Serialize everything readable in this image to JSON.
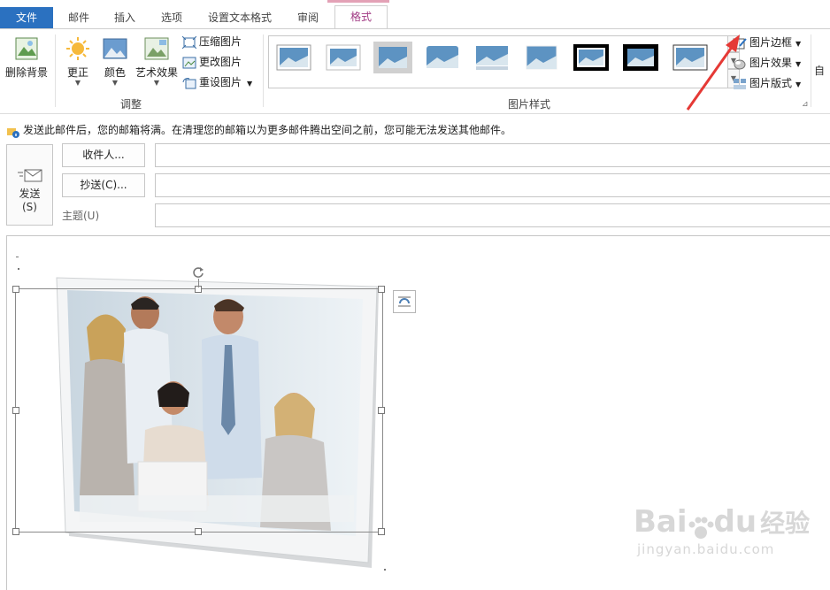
{
  "ribbon": {
    "tabs": [
      {
        "label": "文件",
        "state": "file"
      },
      {
        "label": "邮件",
        "state": ""
      },
      {
        "label": "插入",
        "state": ""
      },
      {
        "label": "选项",
        "state": ""
      },
      {
        "label": "设置文本格式",
        "state": ""
      },
      {
        "label": "审阅",
        "state": ""
      },
      {
        "label": "格式",
        "state": "active"
      }
    ],
    "buttons": {
      "remove_bg": "删除背景",
      "corrections": "更正",
      "color": "颜色",
      "artistic": "艺术效果",
      "compress": "压缩图片",
      "change": "更改图片",
      "reset": "重设图片",
      "border": "图片边框",
      "effects": "图片效果",
      "layout": "图片版式",
      "auto_wrap": "自"
    },
    "groups": {
      "adjust": "调整",
      "styles": "图片样式"
    }
  },
  "infobar": {
    "message": "发送此邮件后，您的邮箱将满。在清理您的邮箱以为更多邮件腾出空间之前，您可能无法发送其他邮件。"
  },
  "header": {
    "send_label": "发送",
    "send_key": "(S)",
    "to_label": "收件人...",
    "cc_label": "抄送(C)...",
    "subject_label": "主题(U)",
    "to_value": "",
    "cc_value": "",
    "subject_value": ""
  },
  "watermark": {
    "brand": "Bai",
    "brand2": "du",
    "brand_cn": "经验",
    "url": "jingyan.baidu.com"
  },
  "colors": {
    "file_tab": "#2b71c0",
    "active_tab_text": "#a13a84",
    "arrow": "#e53935"
  }
}
